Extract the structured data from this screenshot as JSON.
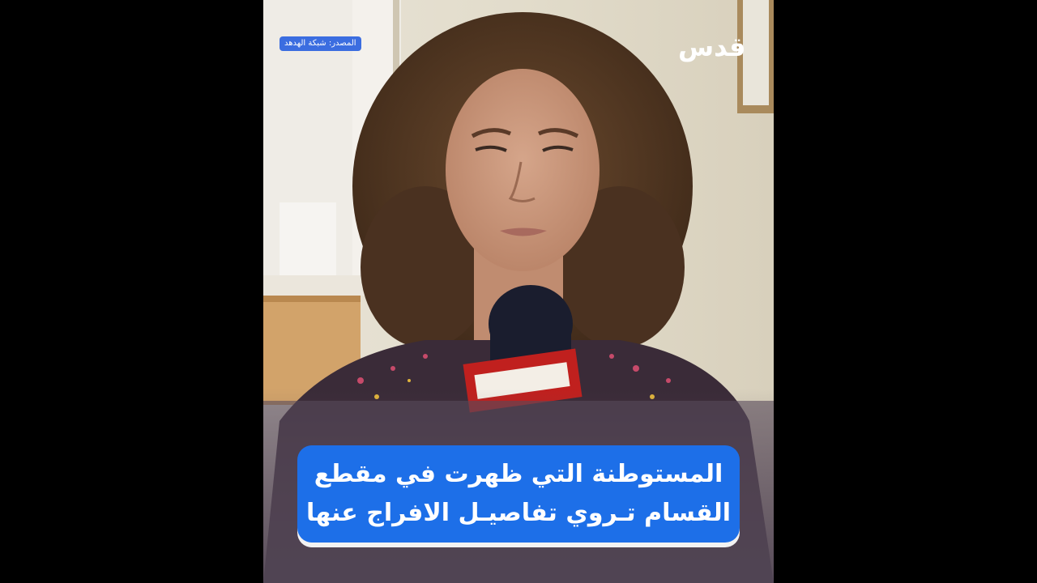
{
  "logo": {
    "text": "قدس"
  },
  "source_badge": {
    "text": "المصدر: شبكة الهدهد"
  },
  "caption": {
    "line1": "المستوطنة التي ظهرت في مقطع",
    "line2": "القسام تـروي تفاصيـل الافراج عنها"
  },
  "colors": {
    "caption_bg": "#1d6fe8",
    "badge_bg": "#3b6de0",
    "letterbox": "#000000"
  },
  "scene": {
    "subject": "woman-speaking-into-microphone"
  }
}
